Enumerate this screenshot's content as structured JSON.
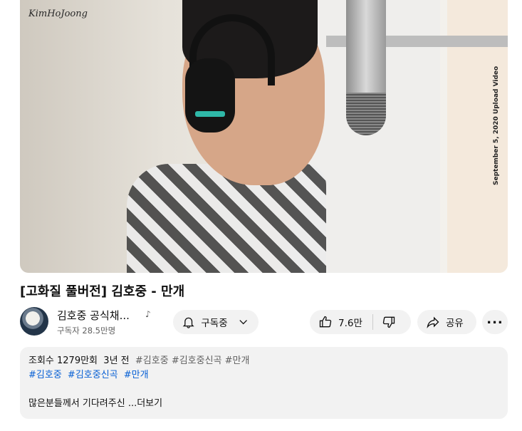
{
  "video": {
    "logo_text": "KimHoJoong",
    "side_text": "September 5, 2020 Upload Video"
  },
  "title": "[고화질 풀버전] 김호중 - 만개",
  "channel": {
    "name": "김호중 공식채...",
    "music_icon": "music-note-icon",
    "subscribers": "구독자 28.5만명"
  },
  "actions": {
    "subscribe_label": "구독중",
    "like_count": "7.6만",
    "share_label": "공유",
    "more_label": "..."
  },
  "description": {
    "views": "조회수 1279만회",
    "age": "3년 전",
    "meta_tags": [
      "#김호중",
      "#김호중신곡",
      "#만개"
    ],
    "hashtags": [
      "#김호중",
      "#김호중신곡",
      "#만개"
    ],
    "preview": "많은분들께서 기다려주신 ",
    "more_label": "...더보기"
  }
}
